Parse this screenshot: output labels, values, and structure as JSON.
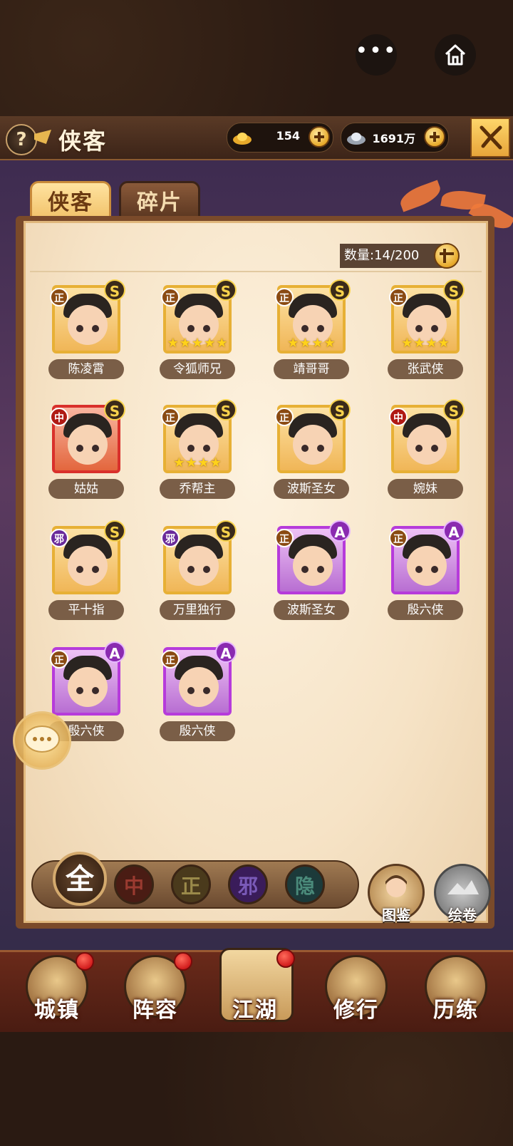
{
  "header": {
    "title": "侠客",
    "help_symbol": "?",
    "gold": {
      "icon": "gold-ingot-icon",
      "value": "154"
    },
    "silver": {
      "icon": "silver-ingot-icon",
      "value": "1691万"
    }
  },
  "tabs": [
    {
      "label": "侠客",
      "active": true
    },
    {
      "label": "碎片",
      "active": false
    }
  ],
  "count": {
    "label": "数量:14/200"
  },
  "heroes": [
    {
      "name": "陈凌霄",
      "align": "正",
      "grade": "S",
      "frame": "gold",
      "stars": 0
    },
    {
      "name": "令狐师兄",
      "align": "正",
      "grade": "S",
      "frame": "gold",
      "stars": 5
    },
    {
      "name": "靖哥哥",
      "align": "正",
      "grade": "S",
      "frame": "gold",
      "stars": 4
    },
    {
      "name": "张武侠",
      "align": "正",
      "grade": "S",
      "frame": "gold",
      "stars": 4
    },
    {
      "name": "姑姑",
      "align": "中",
      "grade": "S",
      "frame": "red",
      "stars": 0
    },
    {
      "name": "乔帮主",
      "align": "正",
      "grade": "S",
      "frame": "gold",
      "stars": 4
    },
    {
      "name": "波斯圣女",
      "align": "正",
      "grade": "S",
      "frame": "gold",
      "stars": 0
    },
    {
      "name": "婉妹",
      "align": "中",
      "grade": "S",
      "frame": "gold",
      "stars": 0
    },
    {
      "name": "平十指",
      "align": "邪",
      "grade": "S",
      "frame": "gold",
      "stars": 0
    },
    {
      "name": "万里独行",
      "align": "邪",
      "grade": "S",
      "frame": "gold",
      "stars": 0
    },
    {
      "name": "波斯圣女",
      "align": "正",
      "grade": "A",
      "frame": "purple",
      "stars": 0
    },
    {
      "name": "殷六侠",
      "align": "正",
      "grade": "A",
      "frame": "purple",
      "stars": 0
    },
    {
      "name": "殷六侠",
      "align": "正",
      "grade": "A",
      "frame": "purple",
      "stars": 0
    },
    {
      "name": "殷六侠",
      "align": "正",
      "grade": "A",
      "frame": "purple",
      "stars": 0
    }
  ],
  "filters": [
    {
      "label": "全",
      "key": "all"
    },
    {
      "label": "中",
      "key": "zhong"
    },
    {
      "label": "正",
      "key": "zheng"
    },
    {
      "label": "邪",
      "key": "xie"
    },
    {
      "label": "隐",
      "key": "yin"
    }
  ],
  "side_buttons": [
    {
      "label": "图鉴",
      "icon": "codex-icon"
    },
    {
      "label": "绘卷",
      "icon": "scroll-painting-icon"
    }
  ],
  "nav": [
    {
      "label": "城镇",
      "icon": "town-icon",
      "dot": true
    },
    {
      "label": "阵容",
      "icon": "lineup-icon",
      "dot": true
    },
    {
      "label": "江湖",
      "icon": "scroll-icon",
      "dot": true
    },
    {
      "label": "修行",
      "icon": "training-icon",
      "dot": false
    },
    {
      "label": "历练",
      "icon": "adventure-icon",
      "dot": false
    }
  ],
  "colors": {
    "frame_gold": "#e7b035",
    "frame_red": "#d9302b",
    "frame_purple": "#b63bdb",
    "name_plate": "#7a5e47"
  }
}
